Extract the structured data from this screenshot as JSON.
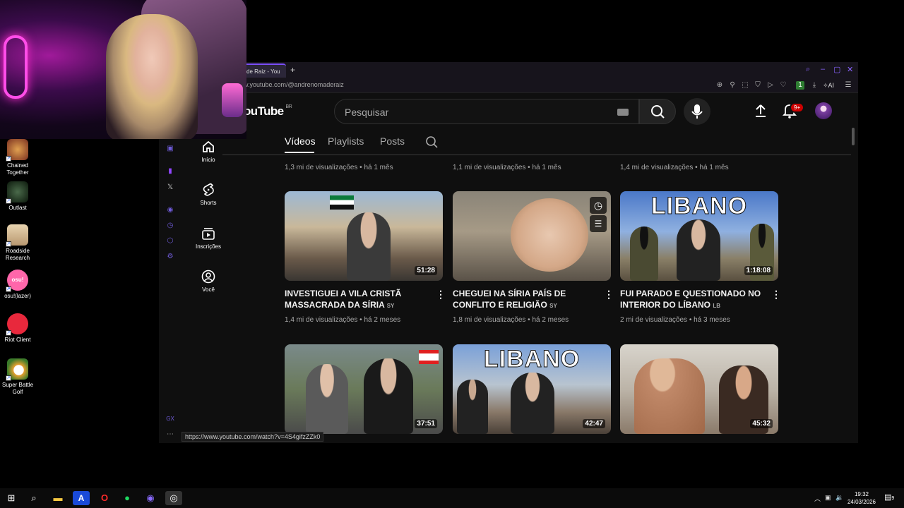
{
  "browser": {
    "tab_title": "de Raiz - You",
    "new_tab": "+",
    "url": "w.youtube.com/@andrenomaderaiz",
    "ai_label": "AI",
    "toolbar_badge": "1"
  },
  "youtube": {
    "logo_text": "ouTube",
    "logo_region": "BR",
    "search_placeholder": "Pesquisar",
    "notifications_badge": "9+",
    "nav": [
      {
        "label": "Início"
      },
      {
        "label": "Shorts"
      },
      {
        "label": "Inscrições"
      },
      {
        "label": "Você"
      }
    ],
    "tabs": [
      {
        "label": "Vídeos",
        "active": true
      },
      {
        "label": "Playlists",
        "active": false
      },
      {
        "label": "Posts",
        "active": false
      }
    ],
    "prev_row_meta": [
      "1,3 mi de visualizações • há 1 mês",
      "1,1 mi de visualizações • há 1 mês",
      "1,4 mi de visualizações • há 1 mês"
    ],
    "videos": [
      {
        "title": "INVESTIGUEI A VILA CRISTÃ MASSACRADA DA SÍRIA",
        "country": "SY",
        "meta": "1,4 mi de visualizações • há 2 meses",
        "duration": "51:28"
      },
      {
        "title": "CHEGUEI NA SÍRIA PAÍS DE CONFLITO E RELIGIÃO",
        "country": "SY",
        "meta": "1,8 mi de visualizações • há 2 meses",
        "duration": ""
      },
      {
        "title": "FUI PARADO E QUESTIONADO NO INTERIOR DO LÍBANO",
        "country": "LB",
        "meta": "2 mi de visualizações • há 3 meses",
        "duration": "1:18:08",
        "overlay_text": "LIBANO"
      },
      {
        "duration": "37:51"
      },
      {
        "duration": "42:47",
        "overlay_text": "LIBANO"
      },
      {
        "duration": "45:32"
      }
    ],
    "status_url": "https://www.youtube.com/watch?v=4S4gifzZZk0"
  },
  "desktop_icons": [
    {
      "label": "Chained Together"
    },
    {
      "label": "Outlast"
    },
    {
      "label": "Roadside Research"
    },
    {
      "label": "osu!(lazer)"
    },
    {
      "label": "Riot Client"
    },
    {
      "label": "Super Battle Golf"
    }
  ],
  "taskbar": {
    "time": "19:32",
    "date": "24/03/2026",
    "notification_count": "9"
  },
  "colors": {
    "yt_bg": "#0f0f0f",
    "opera_accent": "#7b4dff",
    "badge_red": "#cc0000",
    "taskbar_bg": "#0b0b0b"
  }
}
